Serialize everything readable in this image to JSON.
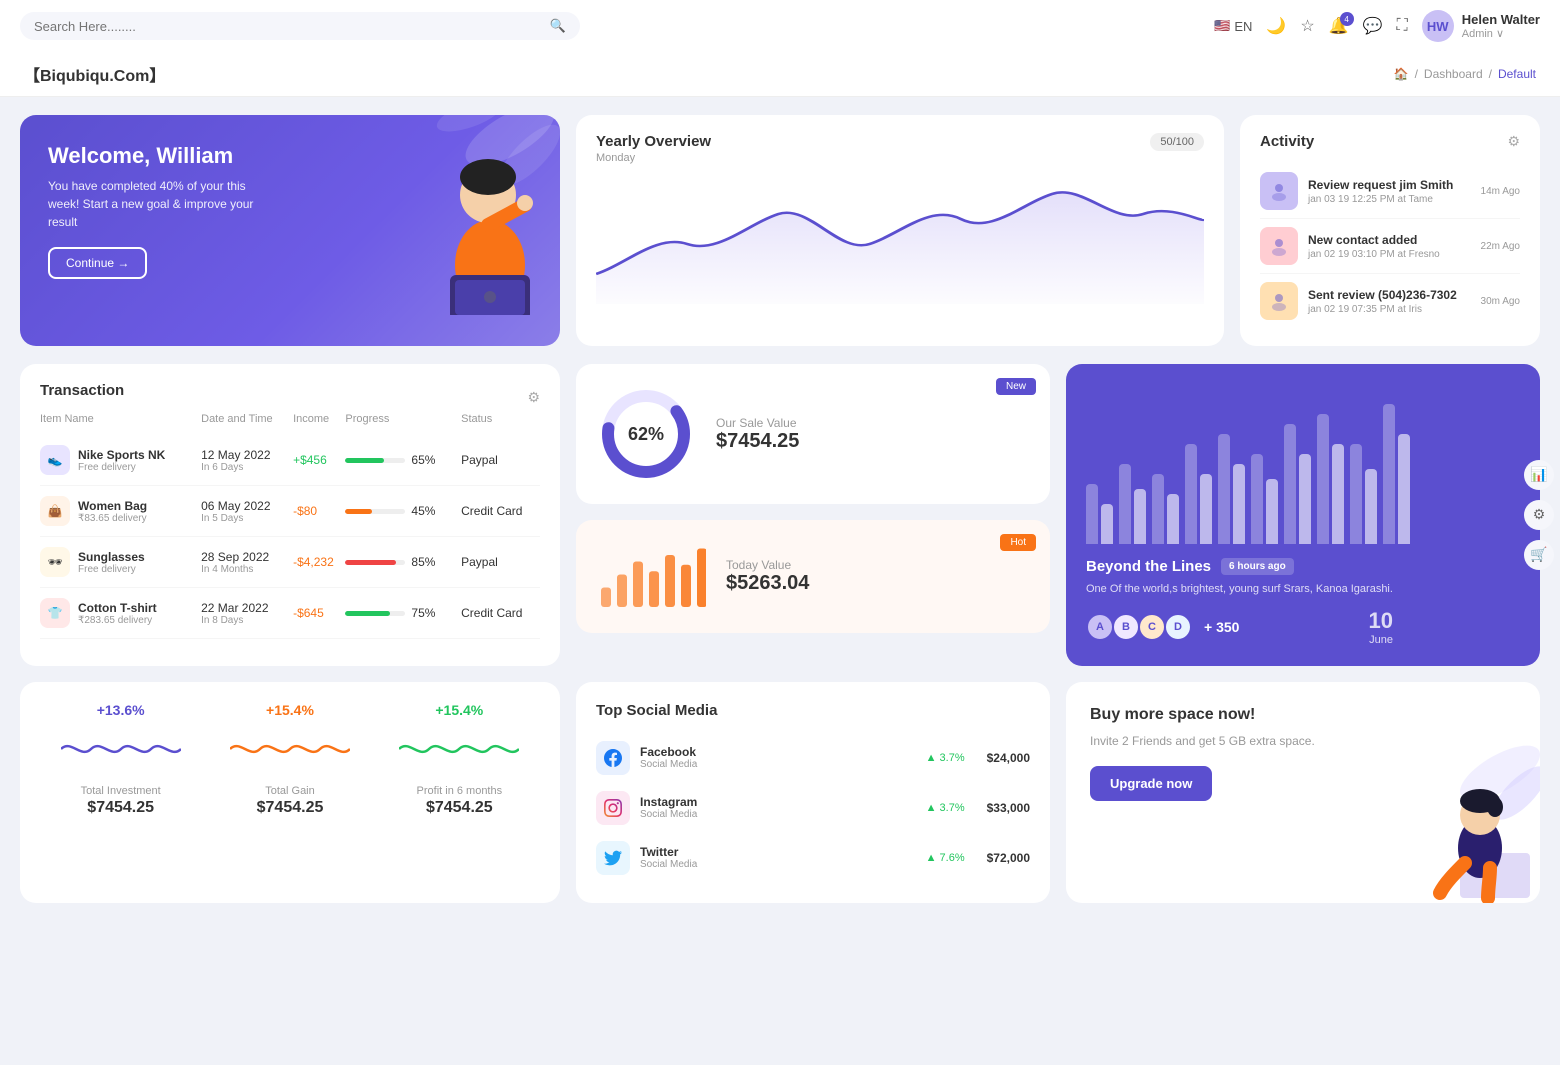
{
  "brand": "【Biqubiqu.Com】",
  "breadcrumb": {
    "home": "🏠",
    "separator": "/",
    "dashboard": "Dashboard",
    "current": "Default"
  },
  "search": {
    "placeholder": "Search Here........"
  },
  "nav": {
    "lang": "EN",
    "user": {
      "name": "Helen Walter",
      "role": "Admin ∨"
    },
    "notifications": "4"
  },
  "welcome": {
    "title": "Welcome, William",
    "subtitle": "You have completed 40% of your this week! Start a new goal & improve your result",
    "button": "Continue →"
  },
  "yearly": {
    "title": "Yearly Overview",
    "subtitle": "Monday",
    "progress": "50/100"
  },
  "activity": {
    "title": "Activity",
    "items": [
      {
        "title": "Review request jim Smith",
        "sub": "jan 03 19 12:25 PM at Tame",
        "time": "14m Ago"
      },
      {
        "title": "New contact added",
        "sub": "jan 02 19 03:10 PM at Fresno",
        "time": "22m Ago"
      },
      {
        "title": "Sent review (504)236-7302",
        "sub": "jan 02 19 07:35 PM at Iris",
        "time": "30m Ago"
      }
    ]
  },
  "transaction": {
    "title": "Transaction",
    "columns": [
      "Item Name",
      "Date and Time",
      "Income",
      "Progress",
      "Status"
    ],
    "rows": [
      {
        "name": "Nike Sports NK",
        "sub": "Free delivery",
        "date": "12 May 2022",
        "days": "In 6 Days",
        "income": "+$456",
        "progress": 65,
        "progressColor": "#22c55e",
        "status": "Paypal",
        "iconBg": "#e8e4ff",
        "iconColor": "#5b4fcf"
      },
      {
        "name": "Women Bag",
        "sub": "₹83.65 delivery",
        "date": "06 May 2022",
        "days": "In 5 Days",
        "income": "-$80",
        "progress": 45,
        "progressColor": "#f97316",
        "status": "Credit Card",
        "iconBg": "#fff3e8",
        "iconColor": "#f97316"
      },
      {
        "name": "Sunglasses",
        "sub": "Free delivery",
        "date": "28 Sep 2022",
        "days": "In 4 Months",
        "income": "-$4,232",
        "progress": 85,
        "progressColor": "#ef4444",
        "status": "Paypal",
        "iconBg": "#fff8e8",
        "iconColor": "#eab308"
      },
      {
        "name": "Cotton T-shirt",
        "sub": "₹283.65 delivery",
        "date": "22 Mar 2022",
        "days": "In 8 Days",
        "income": "-$645",
        "progress": 75,
        "progressColor": "#22c55e",
        "status": "Credit Card",
        "iconBg": "#ffe8e8",
        "iconColor": "#ef4444"
      }
    ]
  },
  "saleValue": {
    "badge": "New",
    "percent": "62%",
    "label": "Our Sale Value",
    "value": "$7454.25"
  },
  "todayValue": {
    "badge": "Hot",
    "label": "Today Value",
    "value": "$5263.04"
  },
  "beyond": {
    "title": "Beyond the Lines",
    "time": "6 hours ago",
    "desc": "One Of the world,s brightest, young surf Srars, Kanoa Igarashi.",
    "count": "+ 350",
    "date": "10",
    "month": "June"
  },
  "stats": [
    {
      "pct": "+13.6%",
      "color": "purple",
      "label": "Total Investment",
      "value": "$7454.25"
    },
    {
      "pct": "+15.4%",
      "color": "orange",
      "label": "Total Gain",
      "value": "$7454.25"
    },
    {
      "pct": "+15.4%",
      "color": "green",
      "label": "Profit in 6 months",
      "value": "$7454.25"
    }
  ],
  "social": {
    "title": "Top Social Media",
    "items": [
      {
        "name": "Facebook",
        "type": "Social Media",
        "pct": "3.7%",
        "amount": "$24,000",
        "icon": "f",
        "iconBg": "#e8f0fe",
        "iconColor": "#1877f2"
      },
      {
        "name": "Instagram",
        "type": "Social Media",
        "pct": "3.7%",
        "amount": "$33,000",
        "icon": "ig",
        "iconBg": "#fce8f3",
        "iconColor": "#e1306c"
      },
      {
        "name": "Twitter",
        "type": "Social Media",
        "pct": "7.6%",
        "amount": "$72,000",
        "icon": "t",
        "iconBg": "#e8f6fe",
        "iconColor": "#1da1f2"
      }
    ]
  },
  "promo": {
    "title": "Buy more space now!",
    "desc": "Invite 2 Friends and get 5 GB extra space.",
    "button": "Upgrade now"
  },
  "barChart": {
    "groups": [
      {
        "light": 60,
        "dark": 40
      },
      {
        "light": 80,
        "dark": 55
      },
      {
        "light": 70,
        "dark": 50
      },
      {
        "light": 100,
        "dark": 70
      },
      {
        "light": 110,
        "dark": 80
      },
      {
        "light": 90,
        "dark": 65
      },
      {
        "light": 120,
        "dark": 90
      },
      {
        "light": 130,
        "dark": 100
      },
      {
        "light": 100,
        "dark": 75
      },
      {
        "light": 140,
        "dark": 110
      }
    ]
  },
  "todayBars": [
    30,
    50,
    70,
    55,
    80,
    65,
    90
  ]
}
